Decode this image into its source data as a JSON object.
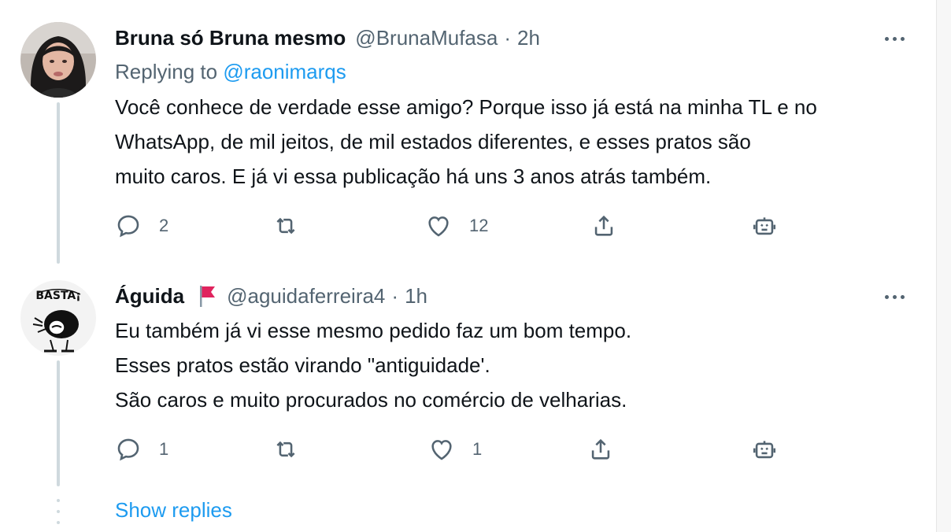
{
  "tweets": [
    {
      "name": "Bruna só Bruna mesmo",
      "handle": "@BrunaMufasa",
      "separator": "·",
      "time": "2h",
      "replying_prefix": "Replying to",
      "replying_handle": "@raonimarqs",
      "text_lines": [
        "Você conhece de verdade esse amigo? Porque isso já está na minha TL e no",
        "WhatsApp, de mil jeitos, de mil estados diferentes, e esses pratos são",
        "muito caros. E já vi essa publicação há uns 3 anos atrás também."
      ],
      "replies": "2",
      "retweets": "",
      "likes": "12"
    },
    {
      "name": "Águida",
      "flag_icon": "red-flag-icon",
      "handle": "@aguidaferreira4",
      "separator": "·",
      "time": "1h",
      "avatar_caption": "BASTA¡",
      "text_lines": [
        "Eu também já vi esse mesmo pedido faz um bom tempo.",
        "Esses pratos estão virando \"antiguidade'.",
        "São caros e muito procurados no comércio de  velharias."
      ],
      "replies": "1",
      "retweets": "",
      "likes": "1"
    }
  ],
  "show_replies_label": "Show replies",
  "icons": [
    "reply-icon",
    "retweet-icon",
    "like-icon",
    "share-icon",
    "robot-icon",
    "more-icon"
  ],
  "colors": {
    "link": "#1d9bf0",
    "secondary_text": "#536471",
    "primary_text": "#0f1419",
    "thread_line": "#cfd9de",
    "flag": "#e0245e"
  }
}
